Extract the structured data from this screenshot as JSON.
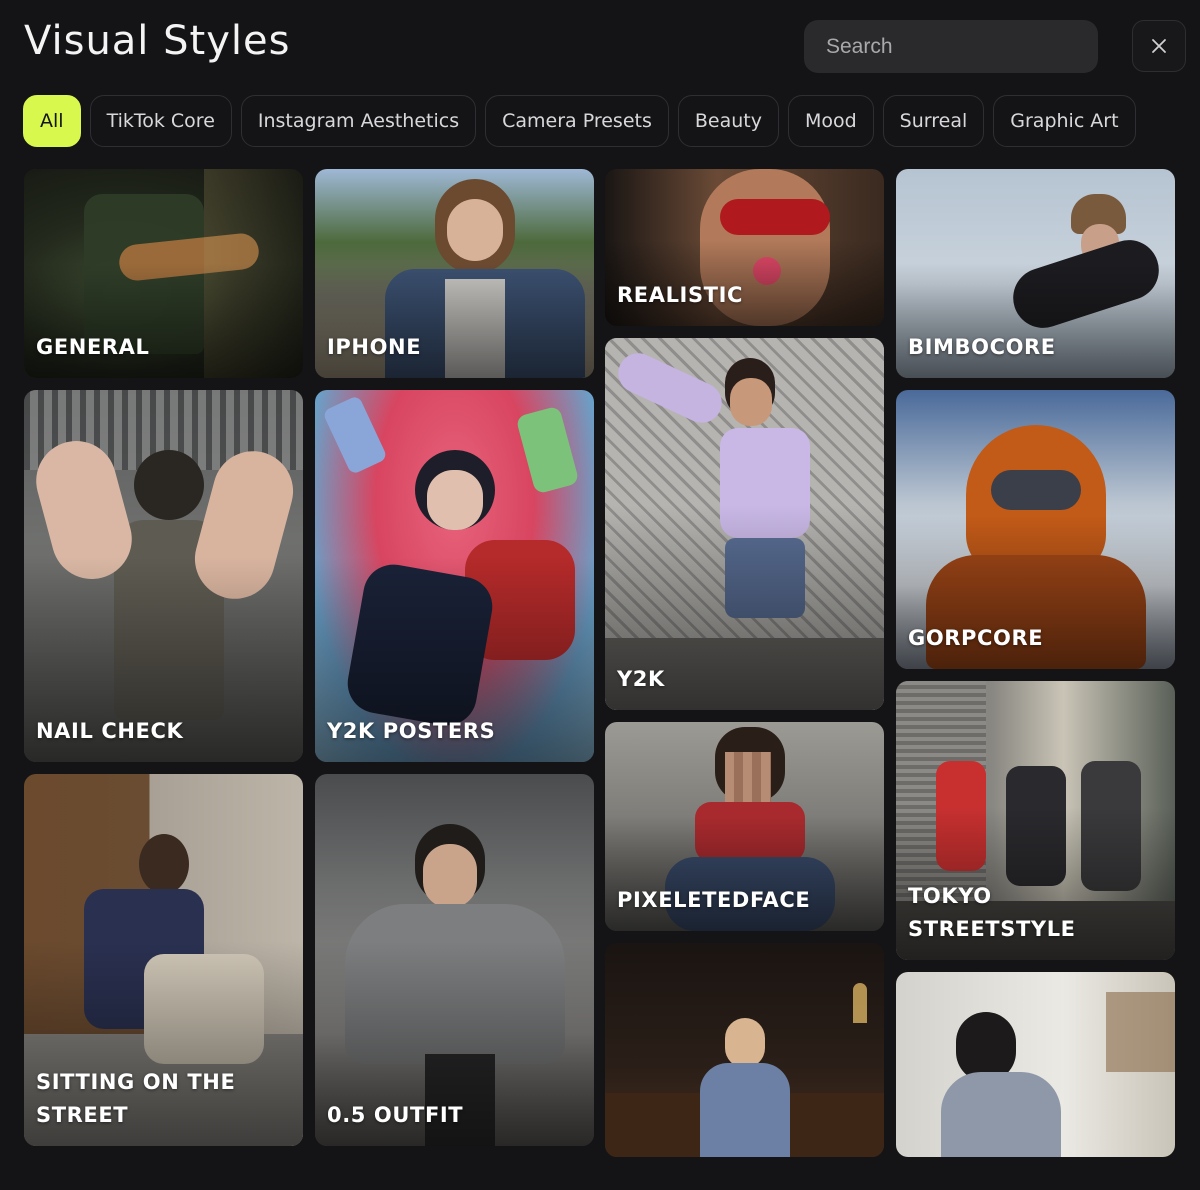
{
  "header": {
    "title": "Visual Styles",
    "search_placeholder": "Search",
    "close_icon": "close-icon"
  },
  "tabs": [
    {
      "label": "All",
      "active": true
    },
    {
      "label": "TikTok Core",
      "active": false
    },
    {
      "label": "Instagram Aesthetics",
      "active": false
    },
    {
      "label": "Camera Presets",
      "active": false
    },
    {
      "label": "Beauty",
      "active": false
    },
    {
      "label": "Mood",
      "active": false
    },
    {
      "label": "Surreal",
      "active": false
    },
    {
      "label": "Graphic Art",
      "active": false
    }
  ],
  "styles": [
    {
      "label": "GENERAL"
    },
    {
      "label": "IPHONE"
    },
    {
      "label": "REALISTIC"
    },
    {
      "label": "BIMBOCORE"
    },
    {
      "label": "NAIL CHECK"
    },
    {
      "label": "Y2K POSTERS"
    },
    {
      "label": "Y2K"
    },
    {
      "label": "GORPCORE"
    },
    {
      "label": "SITTING ON THE STREET"
    },
    {
      "label": "0.5 OUTFIT"
    },
    {
      "label": "PIXELETEDFACE"
    },
    {
      "label": "TOKYO STREETSTYLE"
    },
    {
      "label": ""
    },
    {
      "label": ""
    }
  ],
  "colors": {
    "accent": "#d8f84e",
    "background": "#141416",
    "search_bg": "#2a2a2c"
  }
}
